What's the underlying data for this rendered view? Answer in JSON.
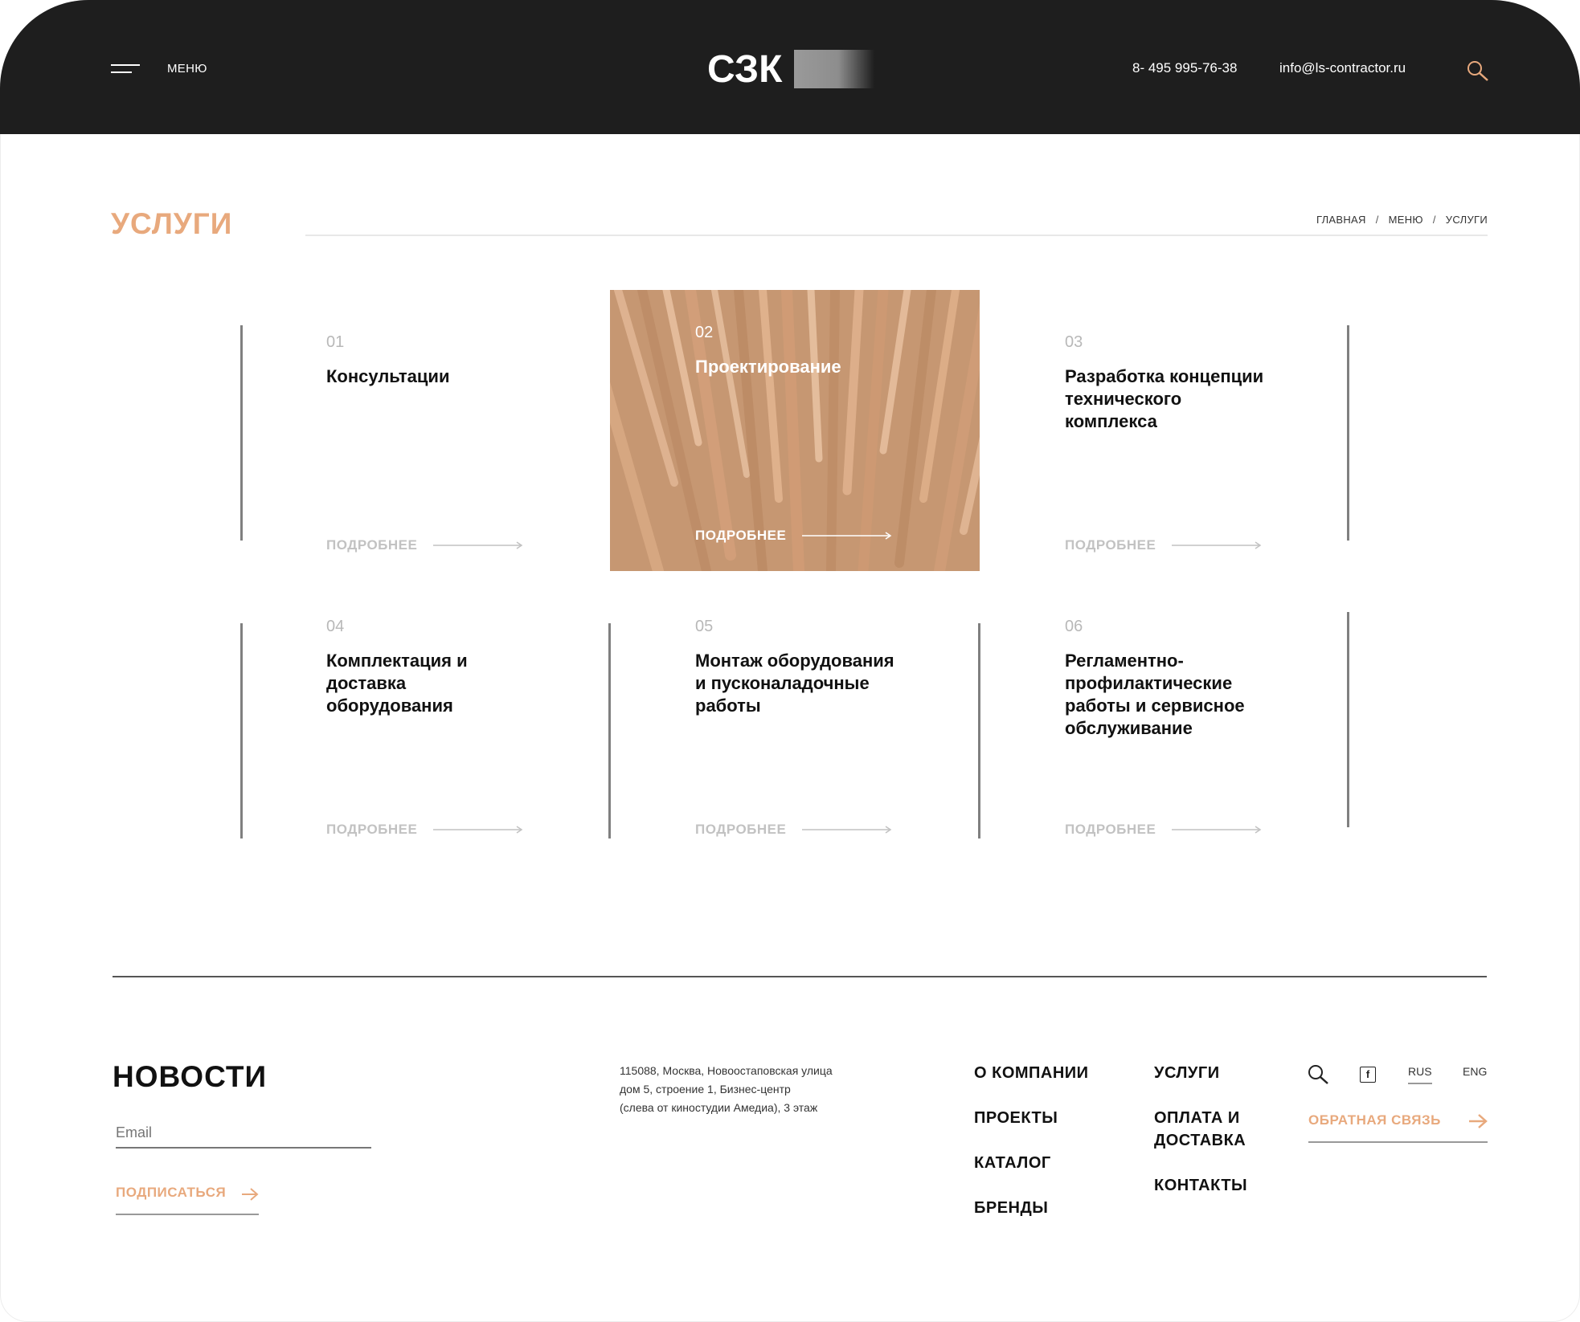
{
  "header": {
    "menu_label": "МЕНЮ",
    "logo_text": "СЗК",
    "phone": "8- 495 995-76-38",
    "email": "info@ls-contractor.ru"
  },
  "page": {
    "title": "УСЛУГИ",
    "breadcrumb": [
      "ГЛАВНАЯ",
      "МЕНЮ",
      "УСЛУГИ"
    ],
    "breadcrumb_sep": "/"
  },
  "services": [
    {
      "num": "01",
      "name": "Консультации",
      "more": "ПОДРОБНЕЕ"
    },
    {
      "num": "02",
      "name": "Проектирование",
      "more": "ПОДРОБНЕЕ"
    },
    {
      "num": "03",
      "name": "Разработка концепции технического комплекса",
      "more": "ПОДРОБНЕЕ"
    },
    {
      "num": "04",
      "name": "Комплектация и доставка оборудования",
      "more": "ПОДРОБНЕЕ"
    },
    {
      "num": "05",
      "name": "Монтаж оборудования и пусконаладочные работы",
      "more": "ПОДРОБНЕЕ"
    },
    {
      "num": "06",
      "name": "Регламентно-профилактические работы и сервисное обслуживание",
      "more": "ПОДРОБНЕЕ"
    }
  ],
  "footer": {
    "news_title": "НОВОСТИ",
    "email_placeholder": "Email",
    "subscribe_label": "ПОДПИСАТЬСЯ",
    "address_lines": [
      "115088, Москва, Новоостаповская улица",
      "дом 5, строение 1, Бизнес-центр",
      "(слева от киностудии Амедиа), 3 этаж"
    ],
    "nav_col1": [
      "О КОМПАНИИ",
      "ПРОЕКТЫ",
      "КАТАЛОГ",
      "БРЕНДЫ"
    ],
    "nav_col2": [
      "УСЛУГИ",
      "ОПЛАТА И ДОСТАВКА",
      "КОНТАКТЫ"
    ],
    "social_fb": "f",
    "lang_rus": "RUS",
    "lang_eng": "ENG",
    "feedback_label": "ОБРАТНАЯ СВЯЗЬ"
  },
  "colors": {
    "accent": "#e8a97d",
    "header_bg": "#1e1e1e",
    "active_card": "#c99a74"
  },
  "icons": [
    "menu-icon",
    "search-icon",
    "arrow-right-icon",
    "facebook-icon"
  ]
}
